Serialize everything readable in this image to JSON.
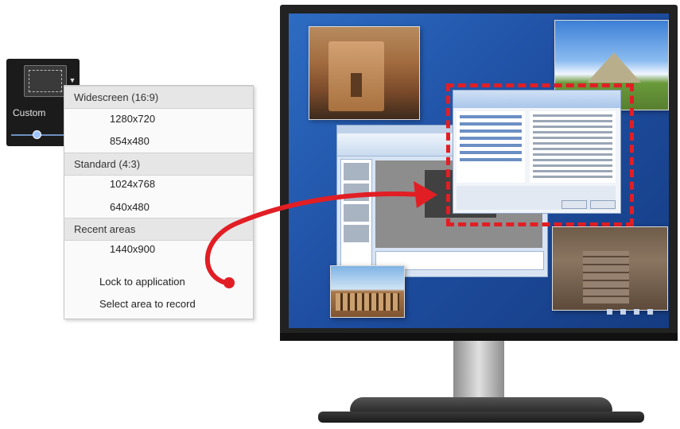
{
  "toolbar": {
    "label": "Custom",
    "dropdown_icon": "triangle-down-icon"
  },
  "menu": {
    "sections": [
      {
        "header": "Widescreen (16:9)",
        "items": [
          "1280x720",
          "854x480"
        ]
      },
      {
        "header": "Standard (4:3)",
        "items": [
          "1024x768",
          "640x480"
        ]
      },
      {
        "header": "Recent areas",
        "items": [
          "1440x900"
        ]
      }
    ],
    "actions": [
      "Lock to application",
      "Select area to record"
    ]
  },
  "colors": {
    "arrow": "#e21e25",
    "selection_border": "#e21e25",
    "menu_header_bg": "#e6e6e6",
    "desktop_blue": "#2d6cc2"
  },
  "icons": {
    "arrow": "curved-arrow-icon",
    "monitor": "monitor-icon"
  }
}
